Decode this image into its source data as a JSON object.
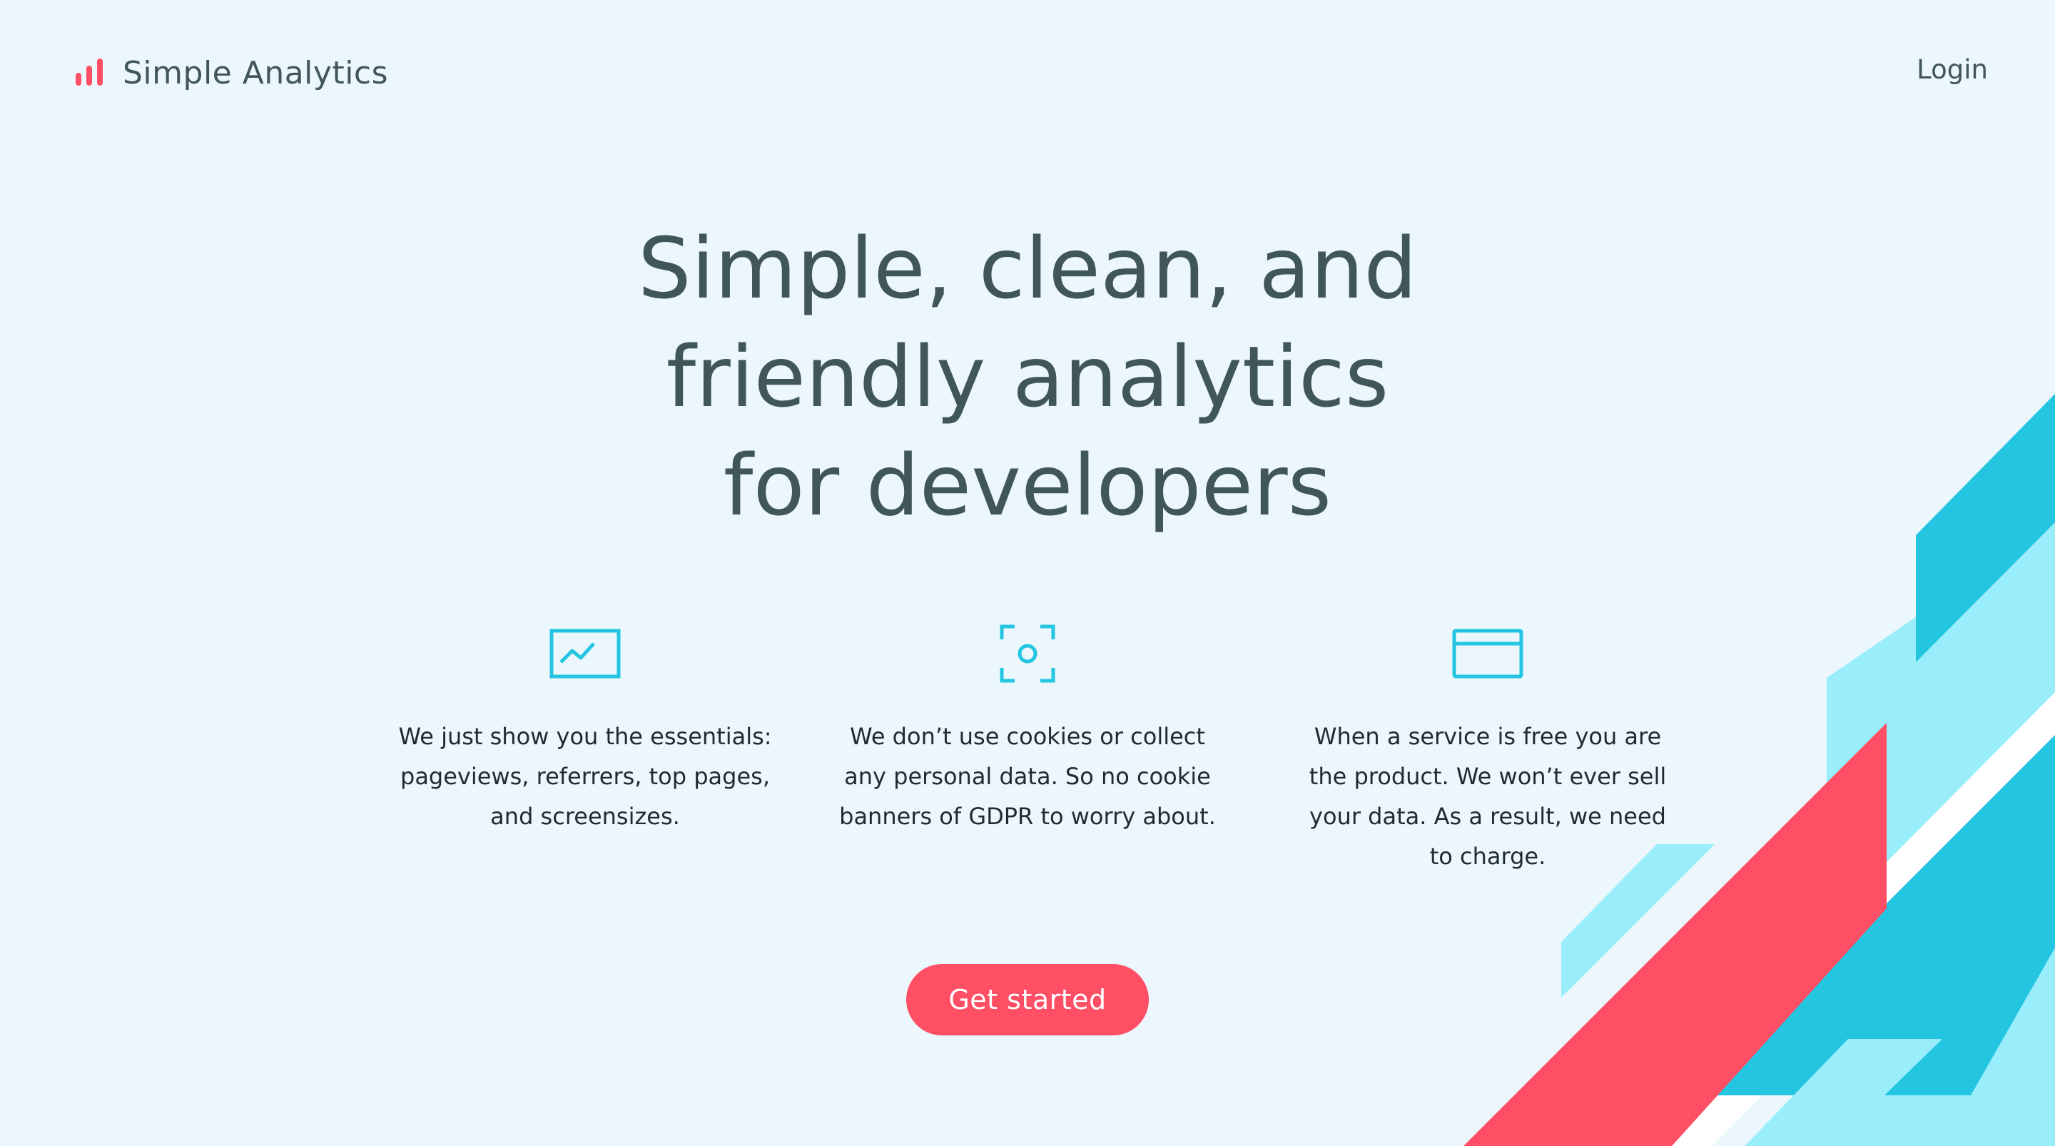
{
  "header": {
    "brand": "Simple Analytics",
    "login_label": "Login"
  },
  "hero": {
    "title_lines": [
      "Simple, clean, and",
      "friendly analytics",
      "for developers"
    ]
  },
  "features": [
    {
      "icon": "chart-icon",
      "lines": [
        "We just show you the essentials:",
        "pageviews, referrers, top pages,",
        "and screensizes."
      ]
    },
    {
      "icon": "privacy-focus-icon",
      "lines": [
        "We don’t use cookies or collect",
        "any personal data. So no cookie",
        "banners of GDPR to worry about."
      ]
    },
    {
      "icon": "credit-card-icon",
      "lines": [
        "When a service is free you are",
        "the product. We won’t ever sell",
        "your data. As a result, we need",
        "to charge."
      ]
    }
  ],
  "cta": {
    "label": "Get started"
  },
  "colors": {
    "background": "#ebf7fd",
    "text": "#415659",
    "accent_red": "#ff4f64",
    "accent_blue": "#23c5e0",
    "accent_light_blue": "#9aeefb"
  }
}
